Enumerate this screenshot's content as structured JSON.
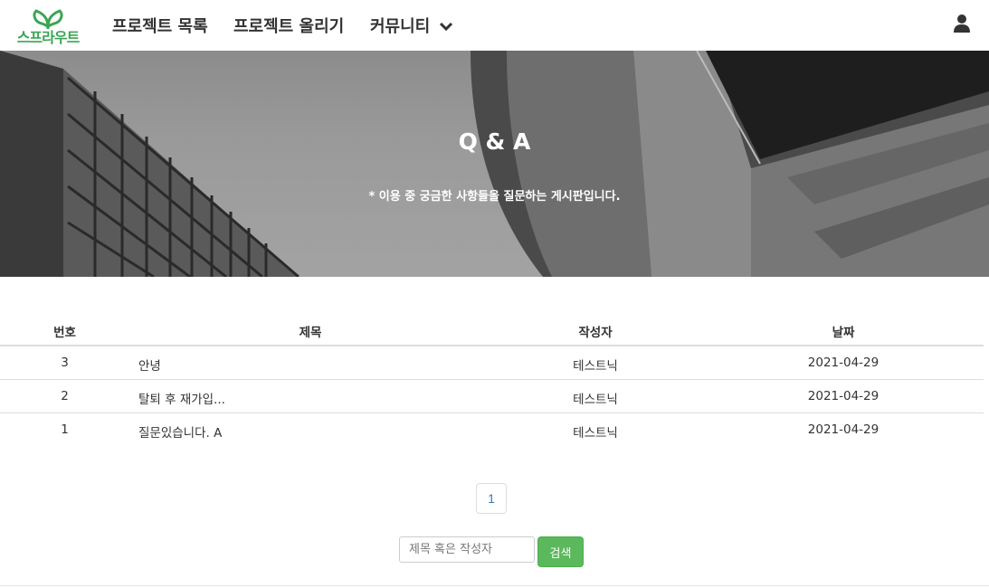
{
  "brand": {
    "logo_text": "스프라우트",
    "logo_color": "#3aa655"
  },
  "nav": {
    "items": [
      {
        "label": "프로젝트 목록"
      },
      {
        "label": "프로젝트 올리기"
      },
      {
        "label": "커뮤니티"
      }
    ],
    "icons": [
      "chevron-down-icon",
      "user-icon"
    ]
  },
  "hero": {
    "title": "Q & A",
    "subtitle": "* 이용 중 궁금한 사항들을 질문하는 게시판입니다."
  },
  "table": {
    "headers": {
      "num": "번호",
      "title": "제목",
      "author": "작성자",
      "date": "날짜"
    },
    "rows": [
      {
        "num": "3",
        "title": "안녕",
        "author": "테스트닉",
        "date": "2021-04-29"
      },
      {
        "num": "2",
        "title": "탈퇴 후 재가입...",
        "author": "테스트닉",
        "date": "2021-04-29"
      },
      {
        "num": "1",
        "title": "질문있습니다. A",
        "author": "테스트닉",
        "date": "2021-04-29"
      }
    ]
  },
  "pagination": {
    "current": "1"
  },
  "search": {
    "placeholder": "제목 혹은 작성자",
    "button_label": "검색"
  },
  "colors": {
    "accent_green": "#5cb85c",
    "link_blue": "#337ab7"
  }
}
